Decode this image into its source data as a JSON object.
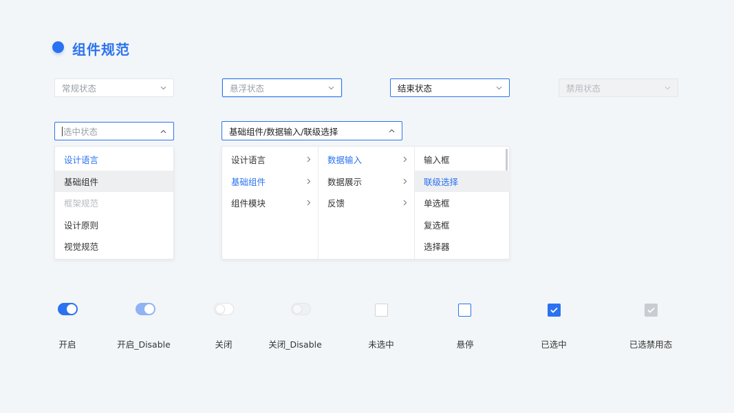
{
  "title": "组件规范",
  "colors": {
    "accent": "#2a72f0",
    "background": "#f3f6f8"
  },
  "selects": {
    "normal": "常规状态",
    "hover": "悬浮状态",
    "done": "结束状态",
    "disabled": "禁用状态",
    "active_placeholder": "选中状态",
    "cascade_value": "基础组件/数据输入/联级选择"
  },
  "dropdown": {
    "items": [
      "设计语言",
      "基础组件",
      "框架规范",
      "设计原则",
      "视觉规范"
    ]
  },
  "cascader": {
    "col1": [
      "设计语言",
      "基础组件",
      "组件模块"
    ],
    "col2": [
      "数据输入",
      "数据展示",
      "反馈"
    ],
    "col3": [
      "输入框",
      "联级选择",
      "单选框",
      "复选框",
      "选择器"
    ]
  },
  "captions": {
    "on": "开启",
    "on_disabled": "开启_Disable",
    "off": "关闭",
    "off_disabled": "关闭_Disable",
    "unchecked": "未选中",
    "hover": "悬停",
    "checked": "已选中",
    "checked_disabled": "已选禁用态"
  },
  "icons": {
    "select_arrow": "chevron-down-icon",
    "select_arrow_open": "chevron-up-icon",
    "submenu": "chevron-right-icon",
    "check": "check-icon"
  }
}
